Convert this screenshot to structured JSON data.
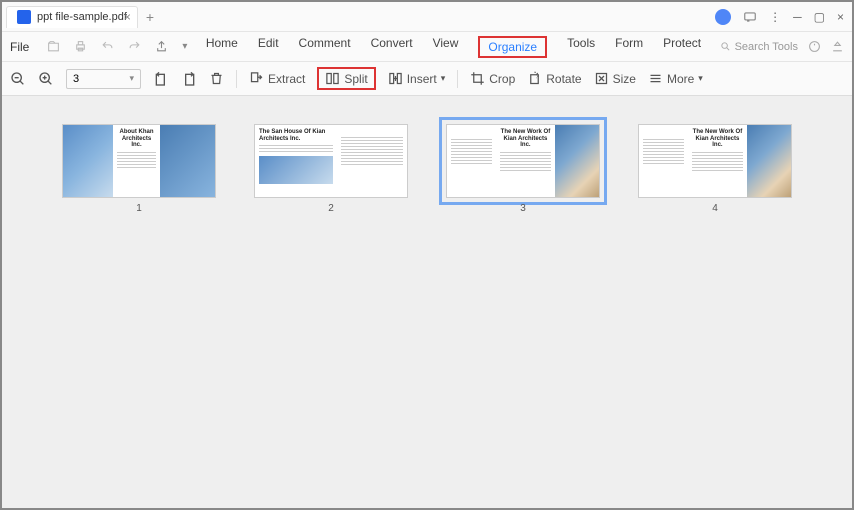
{
  "window": {
    "tab_title": "ppt file-sample.pdf"
  },
  "menubar": {
    "file": "File",
    "items": [
      "Home",
      "Edit",
      "Comment",
      "Convert",
      "View",
      "Organize",
      "Tools",
      "Form",
      "Protect"
    ],
    "active": "Organize",
    "search_placeholder": "Search Tools"
  },
  "toolbar": {
    "page_value": "3",
    "extract": "Extract",
    "split": "Split",
    "insert": "Insert",
    "crop": "Crop",
    "rotate": "Rotate",
    "size": "Size",
    "more": "More"
  },
  "pages": [
    {
      "num": "1",
      "title": "About Khan Architects Inc.",
      "selected": false,
      "variant": "a"
    },
    {
      "num": "2",
      "title": "The San House Of Kian Architects Inc.",
      "selected": false,
      "variant": "b"
    },
    {
      "num": "3",
      "title": "The New Work Of Kian Architects Inc.",
      "selected": true,
      "variant": "c"
    },
    {
      "num": "4",
      "title": "The New Work Of Kian Architects Inc.",
      "selected": false,
      "variant": "c"
    }
  ]
}
